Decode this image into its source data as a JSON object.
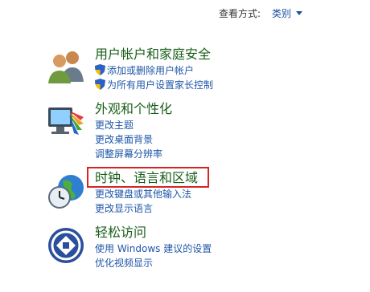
{
  "header": {
    "view_by_label": "查看方式:",
    "view_by_value": "类别"
  },
  "categories": [
    {
      "title": "用户帐户和家庭安全",
      "icon": "users-icon",
      "links": [
        "添加或删除用户帐户",
        "为所有用户设置家长控制"
      ]
    },
    {
      "title": "外观和个性化",
      "icon": "monitor-palette-icon",
      "links": [
        "更改主题",
        "更改桌面背景",
        "调整屏幕分辨率"
      ]
    },
    {
      "title": "时钟、语言和区域",
      "icon": "clock-globe-icon",
      "links": [
        "更改键盘或其他输入法",
        "更改显示语言"
      ]
    },
    {
      "title": "轻松访问",
      "icon": "ease-of-access-icon",
      "links": [
        "使用 Windows 建议的设置",
        "优化视频显示"
      ]
    }
  ],
  "colors": {
    "category_title": "#1a5e1a",
    "link": "#1f56a8",
    "highlight_border": "#d82424"
  }
}
